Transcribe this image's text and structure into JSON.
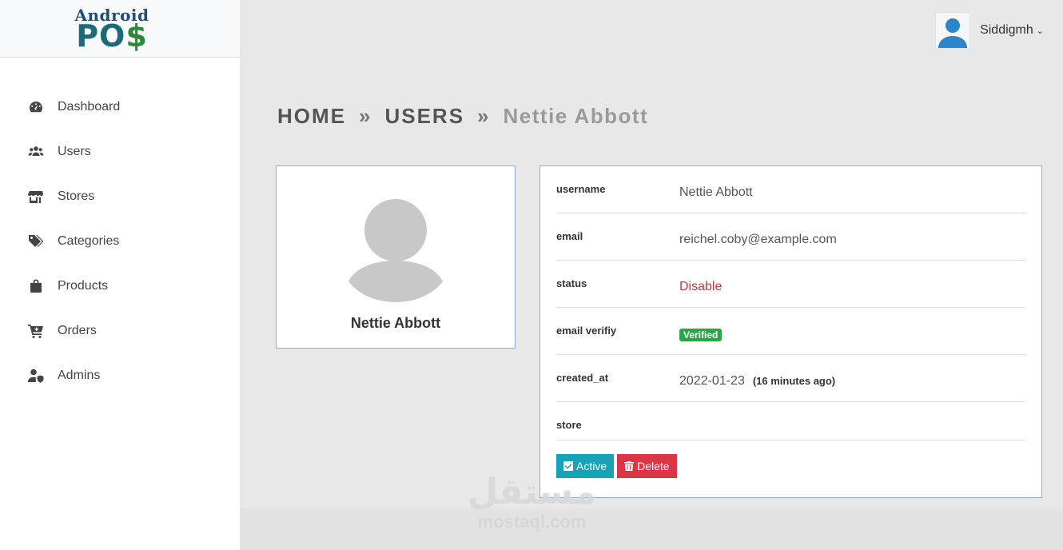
{
  "logo": {
    "line1": "Android",
    "line2a": "PO",
    "line2b": "$"
  },
  "sidebar": {
    "items": [
      {
        "label": "Dashboard",
        "icon": "dashboard-icon"
      },
      {
        "label": "Users",
        "icon": "users-icon"
      },
      {
        "label": "Stores",
        "icon": "store-icon"
      },
      {
        "label": "Categories",
        "icon": "tags-icon"
      },
      {
        "label": "Products",
        "icon": "shopping-bag-icon"
      },
      {
        "label": "Orders",
        "icon": "cart-icon"
      },
      {
        "label": "Admins",
        "icon": "user-shield-icon"
      }
    ]
  },
  "header": {
    "user_name": "Siddigmh",
    "caret": "⌄"
  },
  "breadcrumb": {
    "home": "HOME",
    "sep": "»",
    "users": "USERS",
    "current": "Nettie Abbott"
  },
  "profile": {
    "name": "Nettie Abbott"
  },
  "details": {
    "username": {
      "label": "username",
      "value": "Nettie Abbott"
    },
    "email": {
      "label": "email",
      "value": "reichel.coby@example.com"
    },
    "status": {
      "label": "status",
      "value": "Disable",
      "color": "#d0363e"
    },
    "email_verify": {
      "label": "email verifiy",
      "value": "Verified",
      "color": "#28a745"
    },
    "created_at": {
      "label": "created_at",
      "value": "2022-01-23",
      "ago": "(16 minutes ago)"
    },
    "store": {
      "label": "store",
      "value": ""
    }
  },
  "actions": {
    "active_label": "Active",
    "delete_label": "Delete",
    "active_color": "#17a2b8",
    "delete_color": "#dc3545"
  },
  "watermark": {
    "arabic": "مستقل",
    "latin": "mostaql.com"
  }
}
